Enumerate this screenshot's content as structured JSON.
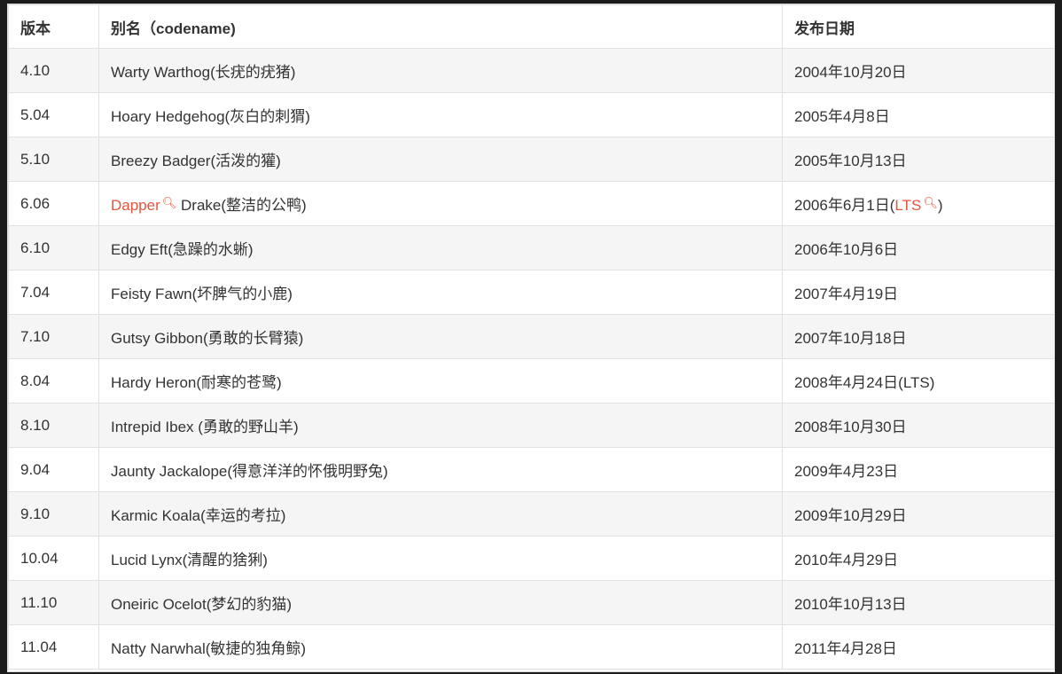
{
  "table": {
    "headers": [
      "版本",
      "别名（codename)",
      "发布日期"
    ],
    "rows": [
      {
        "version": "4.10",
        "codename": "Warty Warthog(长疣的疣猪)",
        "date": "2004年10月20日"
      },
      {
        "version": "5.04",
        "codename": "Hoary Hedgehog(灰白的刺猬)",
        "date": "2005年4月8日"
      },
      {
        "version": "5.10",
        "codename": "Breezy Badger(活泼的獾)",
        "date": "2005年10月13日"
      },
      {
        "version": "6.06",
        "codename_link": "Dapper",
        "codename_rest": "Drake(整洁的公鸭)",
        "date_main": "2006年6月1日(",
        "date_link": "LTS",
        "date_close": ")"
      },
      {
        "version": "6.10",
        "codename": "Edgy Eft(急躁的水蜥)",
        "date": "2006年10月6日"
      },
      {
        "version": "7.04",
        "codename": "Feisty Fawn(坏脾气的小鹿)",
        "date": "2007年4月19日"
      },
      {
        "version": "7.10",
        "codename": "Gutsy Gibbon(勇敢的长臂猿)",
        "date": "2007年10月18日"
      },
      {
        "version": "8.04",
        "codename": "Hardy Heron(耐寒的苍鹭)",
        "date": "2008年4月24日(LTS)"
      },
      {
        "version": "8.10",
        "codename": "Intrepid Ibex (勇敢的野山羊)",
        "date": "2008年10月30日"
      },
      {
        "version": "9.04",
        "codename": "Jaunty Jackalope(得意洋洋的怀俄明野兔)",
        "date": "2009年4月23日"
      },
      {
        "version": "9.10",
        "codename": "Karmic Koala(幸运的考拉)",
        "date": "2009年10月29日"
      },
      {
        "version": "10.04",
        "codename": "Lucid Lynx(清醒的猞猁)",
        "date": "2010年4月29日"
      },
      {
        "version": "11.10",
        "codename": "Oneiric Ocelot(梦幻的豹猫)",
        "date": "2010年10月13日"
      },
      {
        "version": "11.04",
        "codename": "Natty Narwhal(敏捷的独角鲸)",
        "date": "2011年4月28日"
      }
    ]
  },
  "colors": {
    "link": "#e5533c",
    "stripe": "#f5f5f5",
    "border": "#e1e1e1"
  },
  "icons": {
    "link_search": "search-icon"
  }
}
